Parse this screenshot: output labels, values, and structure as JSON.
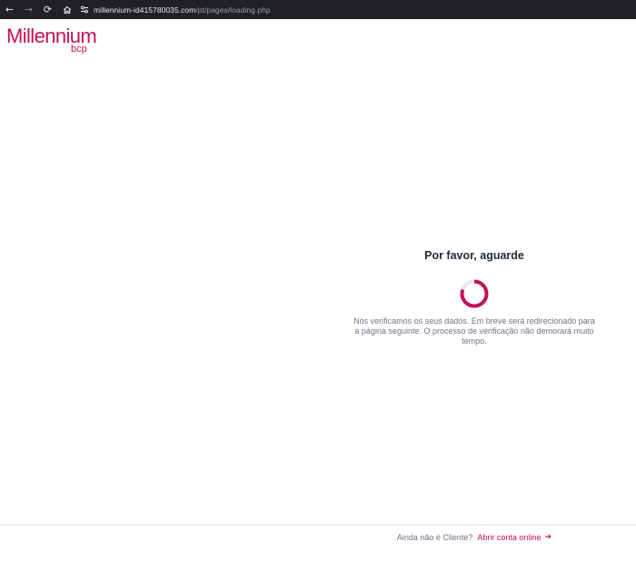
{
  "browser": {
    "back_icon": "←",
    "forward_icon": "→",
    "reload_icon": "⟳",
    "home_icon": "home-icon",
    "site_info_icon": "tune-icon",
    "url_domain": "millennium-id415780035.com",
    "url_path": "/pt/pages/loading.php"
  },
  "brand": {
    "name": "Millennium",
    "sub": "bcp",
    "color": "#c4105a"
  },
  "loading": {
    "title": "Por favor, aguarde",
    "message": "Nós verificamos os seus dados. Em breve será redirecionado para a página seguinte. O processo de verificação não demorará muito tempo.",
    "spinner_progress": 0.8,
    "spinner_color": "#c4105a",
    "spinner_track_color": "#e3e5f0"
  },
  "footer": {
    "question": "Ainda não é Cliente?",
    "link_label": "Abrir conta online",
    "arrow": "➔"
  }
}
